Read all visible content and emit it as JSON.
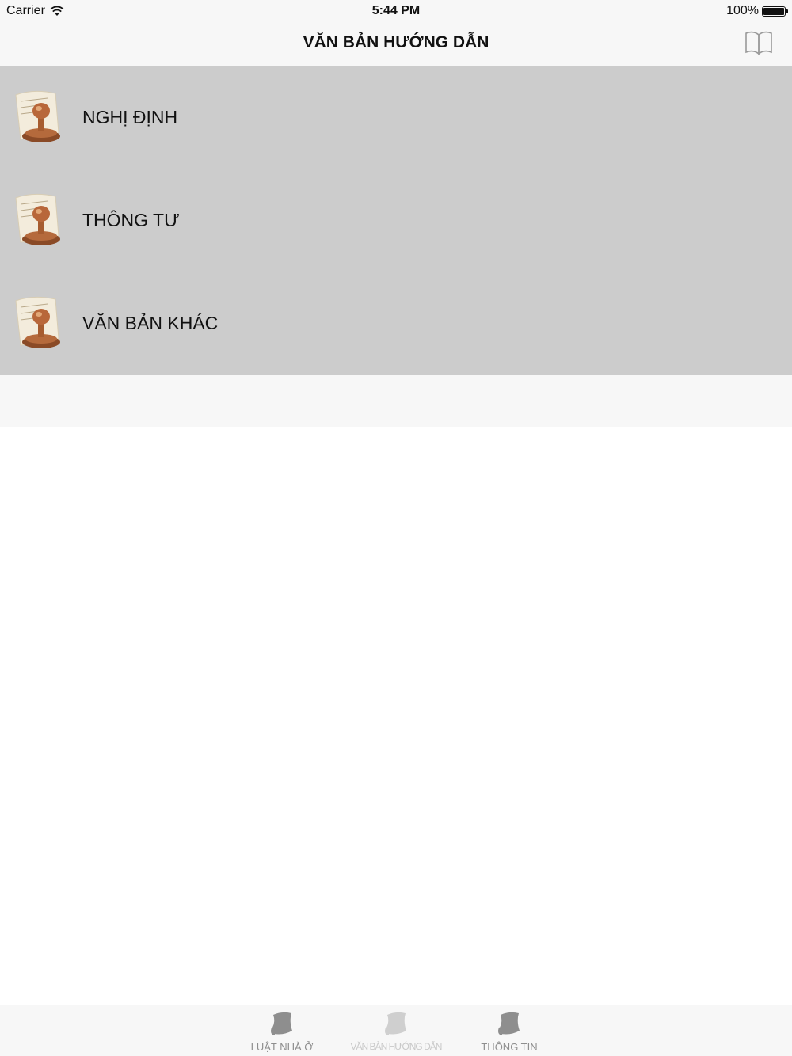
{
  "status_bar": {
    "carrier": "Carrier",
    "time": "5:44 PM",
    "battery": "100%"
  },
  "nav": {
    "title": "VĂN BẢN HƯỚNG DẪN",
    "right_icon": "book-icon"
  },
  "list": {
    "items": [
      {
        "label": "NGHỊ ĐỊNH",
        "icon": "document-stamp-icon"
      },
      {
        "label": "THÔNG TƯ",
        "icon": "document-stamp-icon"
      },
      {
        "label": "VĂN BẢN KHÁC",
        "icon": "document-stamp-icon"
      }
    ]
  },
  "tab_bar": {
    "tabs": [
      {
        "label": "LUẬT NHÀ Ở",
        "icon": "scroll-icon",
        "selected": false
      },
      {
        "label": "VĂN BẢN HƯỚNG DẪN",
        "icon": "scroll-icon",
        "selected": true
      },
      {
        "label": "THÔNG TIN",
        "icon": "scroll-icon",
        "selected": false
      }
    ]
  },
  "colors": {
    "row_bg": "#cccccc",
    "bar_bg": "#f7f7f7",
    "tab_inactive": "#8e8e8e",
    "tab_active": "#c9c9c9"
  }
}
